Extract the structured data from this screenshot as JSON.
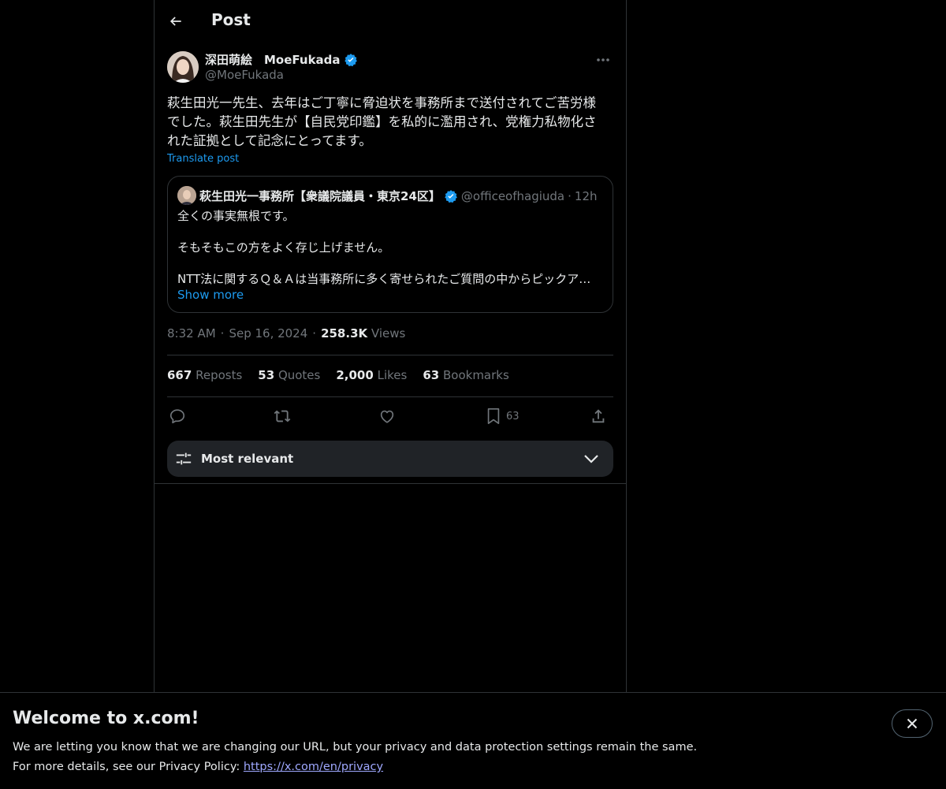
{
  "header": {
    "title": "Post"
  },
  "post": {
    "author_name": "深田萌絵　MoeFukada",
    "author_handle": "@MoeFukada",
    "text": "萩生田光一先生、去年はご丁寧に脅迫状を事務所まで送付されてご苦労様\nでした。萩生田先生が【自民党印鑑】を私的に濫用され、党権力私物化さ\nれた証拠として記念にとってます。",
    "translate_label": "Translate post",
    "time": "8:32 AM",
    "date": "Sep 16, 2024",
    "views_count": "258.3K",
    "views_label": "Views"
  },
  "quote": {
    "name": "萩生田光一事務所【衆議院議員・東京24区】",
    "handle": "@officeofhagiuda",
    "dot": "·",
    "time": "12h",
    "lines": [
      "全くの事実無根です。",
      "そもそもこの方をよく存じ上げません。",
      "NTT法に関するＱ＆Ａは当事務所に多く寄せられたご質問の中からピックアップして"
    ],
    "show_more": "Show more"
  },
  "stats": {
    "reposts_count": "667",
    "reposts_label": "Reposts",
    "quotes_count": "53",
    "quotes_label": "Quotes",
    "likes_count": "2,000",
    "likes_label": "Likes",
    "bookmarks_count": "63",
    "bookmarks_label": "Bookmarks"
  },
  "actions": {
    "bookmark_count": "63"
  },
  "sort": {
    "label": "Most relevant"
  },
  "banner": {
    "title": "Welcome to x.com!",
    "line1": "We are letting you know that we are changing our URL, but your privacy and data protection settings remain the same.",
    "line2_prefix": "For more details, see our Privacy Policy: ",
    "link": "https://x.com/en/privacy"
  },
  "colors": {
    "accent": "#1d9bf0",
    "background": "#000000",
    "border": "#2f3336",
    "muted": "#71767b"
  },
  "icons": [
    "back-arrow-icon",
    "verified-icon",
    "more-icon",
    "reply-icon",
    "repost-icon",
    "like-icon",
    "bookmark-icon",
    "share-icon",
    "sliders-icon",
    "chevron-down-icon",
    "close-icon"
  ]
}
